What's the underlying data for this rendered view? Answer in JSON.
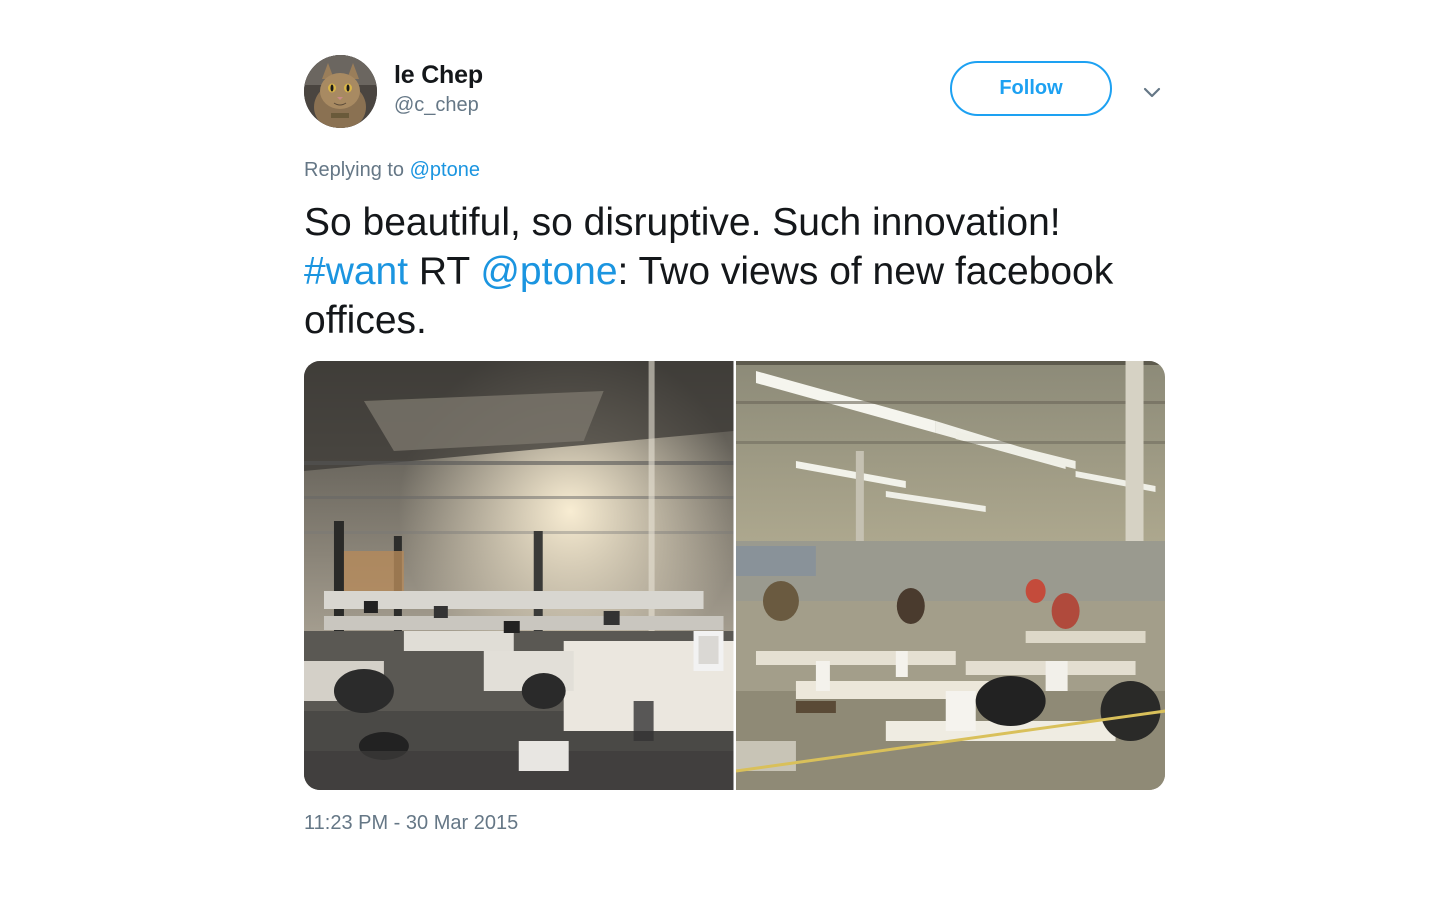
{
  "user": {
    "display_name": "le Chep",
    "handle": "@c_chep",
    "avatar_icon": "cat-avatar"
  },
  "actions": {
    "follow_label": "Follow",
    "menu_icon": "chevron-down-icon"
  },
  "reply": {
    "prefix": "Replying to",
    "to": "@ptone"
  },
  "tweet": {
    "text_part1": "So beautiful, so disruptive. Such innovation! ",
    "hashtag": "#want",
    "text_part2": " RT ",
    "mention": "@ptone",
    "text_part3": ": Two views of new facebook offices."
  },
  "media": {
    "photos": [
      {
        "icon": "open-office-photo"
      },
      {
        "icon": "factory-floor-photo"
      }
    ]
  },
  "timestamp": "11:23 PM - 30 Mar 2015",
  "colors": {
    "accent": "#1da1f2",
    "link": "#1b95e0",
    "text": "#14171a",
    "muted": "#657786"
  }
}
